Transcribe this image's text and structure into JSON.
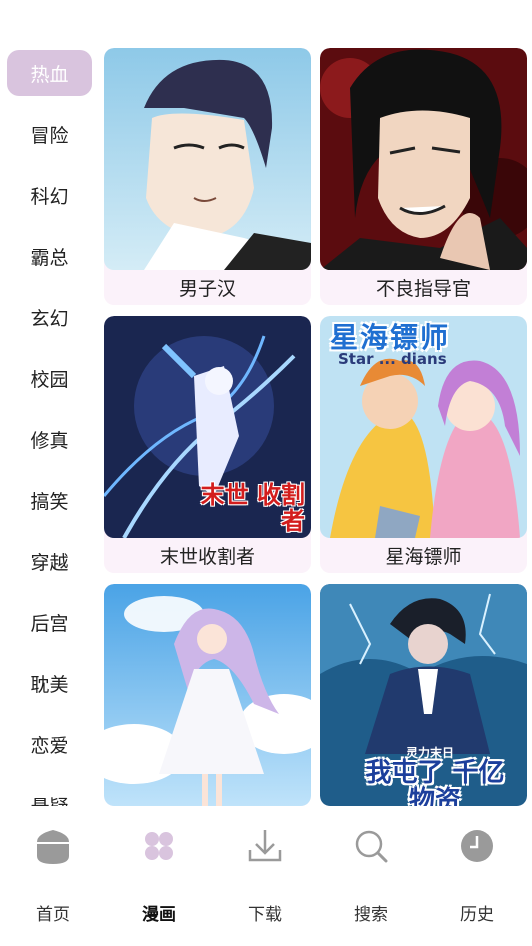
{
  "sidebar": {
    "categories": [
      {
        "label": "热血",
        "active": true
      },
      {
        "label": "冒险"
      },
      {
        "label": "科幻"
      },
      {
        "label": "霸总"
      },
      {
        "label": "玄幻"
      },
      {
        "label": "校园"
      },
      {
        "label": "修真"
      },
      {
        "label": "搞笑"
      },
      {
        "label": "穿越"
      },
      {
        "label": "后宫"
      },
      {
        "label": "耽美"
      },
      {
        "label": "恋爱"
      },
      {
        "label": "悬疑"
      }
    ]
  },
  "comics": [
    {
      "title": "男子汉",
      "cover_text": ""
    },
    {
      "title": "不良指导官",
      "cover_text": ""
    },
    {
      "title": "末世收割者",
      "cover_text": "末世 收割者"
    },
    {
      "title": "星海镖师",
      "cover_text": "星海镖师",
      "cover_subtext": "Star ... dians"
    },
    {
      "title": "",
      "cover_text": ""
    },
    {
      "title": "",
      "cover_text": "我屯了 千亿物资",
      "cover_subtext": "灵力末日"
    }
  ],
  "bottom_nav": {
    "items": [
      {
        "label": "首页",
        "icon": "home-icon"
      },
      {
        "label": "漫画",
        "icon": "comic-grid-icon",
        "active": true
      },
      {
        "label": "下载",
        "icon": "download-icon"
      },
      {
        "label": "搜索",
        "icon": "search-icon"
      },
      {
        "label": "历史",
        "icon": "history-clock-icon"
      }
    ]
  },
  "colors": {
    "accent": "#d9c4de",
    "caption_bg": "#fbf2fa",
    "icon_gray": "#9a9a9a"
  }
}
